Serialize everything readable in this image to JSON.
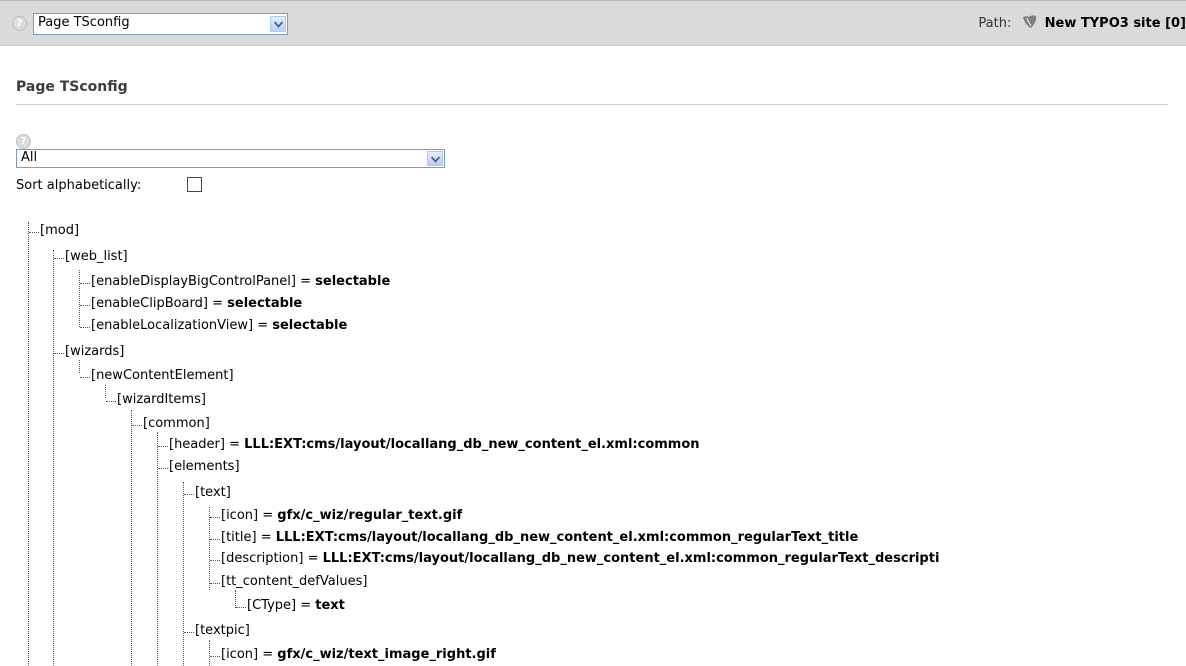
{
  "topbar": {
    "function_select": "Page TSconfig",
    "path_label": "Path:",
    "site_name": "New TYPO3 site [0]"
  },
  "page_title": "Page TSconfig",
  "filter": {
    "select_value": "All",
    "sort_label": "Sort alphabetically:"
  },
  "tree": [
    {
      "key": "[mod]",
      "value": ""
    },
    {
      "key": "[web_list]",
      "value": ""
    },
    {
      "key": "[enableDisplayBigControlPanel]",
      "value": "selectable"
    },
    {
      "key": "[enableClipBoard]",
      "value": "selectable"
    },
    {
      "key": "[enableLocalizationView]",
      "value": "selectable"
    },
    {
      "key": "[wizards]",
      "value": ""
    },
    {
      "key": "[newContentElement]",
      "value": ""
    },
    {
      "key": "[wizardItems]",
      "value": ""
    },
    {
      "key": "[common]",
      "value": ""
    },
    {
      "key": "[header]",
      "value": "LLL:EXT:cms/layout/locallang_db_new_content_el.xml:common"
    },
    {
      "key": "[elements]",
      "value": ""
    },
    {
      "key": "[text]",
      "value": ""
    },
    {
      "key": "[icon]",
      "value": "gfx/c_wiz/regular_text.gif"
    },
    {
      "key": "[title]",
      "value": "LLL:EXT:cms/layout/locallang_db_new_content_el.xml:common_regularText_title"
    },
    {
      "key": "[description]",
      "value": "LLL:EXT:cms/layout/locallang_db_new_content_el.xml:common_regularText_descripti"
    },
    {
      "key": "[tt_content_defValues]",
      "value": ""
    },
    {
      "key": "[CType]",
      "value": "text"
    },
    {
      "key": "[textpic]",
      "value": ""
    },
    {
      "key": "[icon]",
      "value": "gfx/c_wiz/text_image_right.gif"
    }
  ]
}
